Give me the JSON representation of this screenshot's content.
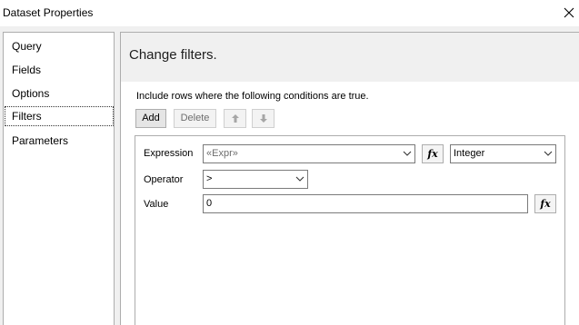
{
  "window": {
    "title": "Dataset Properties",
    "close_icon": "close-icon"
  },
  "nav": {
    "items": [
      {
        "label": "Query"
      },
      {
        "label": "Fields"
      },
      {
        "label": "Options"
      },
      {
        "label": "Filters",
        "selected": true
      },
      {
        "label": "Parameters"
      }
    ]
  },
  "page": {
    "title": "Change filters.",
    "instruction": "Include rows where the following conditions are true."
  },
  "toolbar": {
    "add_label": "Add",
    "delete_label": "Delete",
    "move_up_icon": "arrow-up-icon",
    "move_down_icon": "arrow-down-icon"
  },
  "filter": {
    "expression_label": "Expression",
    "expression_value": "«Expr»",
    "fx_label": "fx",
    "type_value": "Integer",
    "operator_label": "Operator",
    "operator_value": ">",
    "value_label": "Value",
    "value_value": "0"
  },
  "colors": {
    "header_band": "#f0f0f0",
    "border": "#adadad",
    "placeholder_text": "#6d6d6d"
  }
}
